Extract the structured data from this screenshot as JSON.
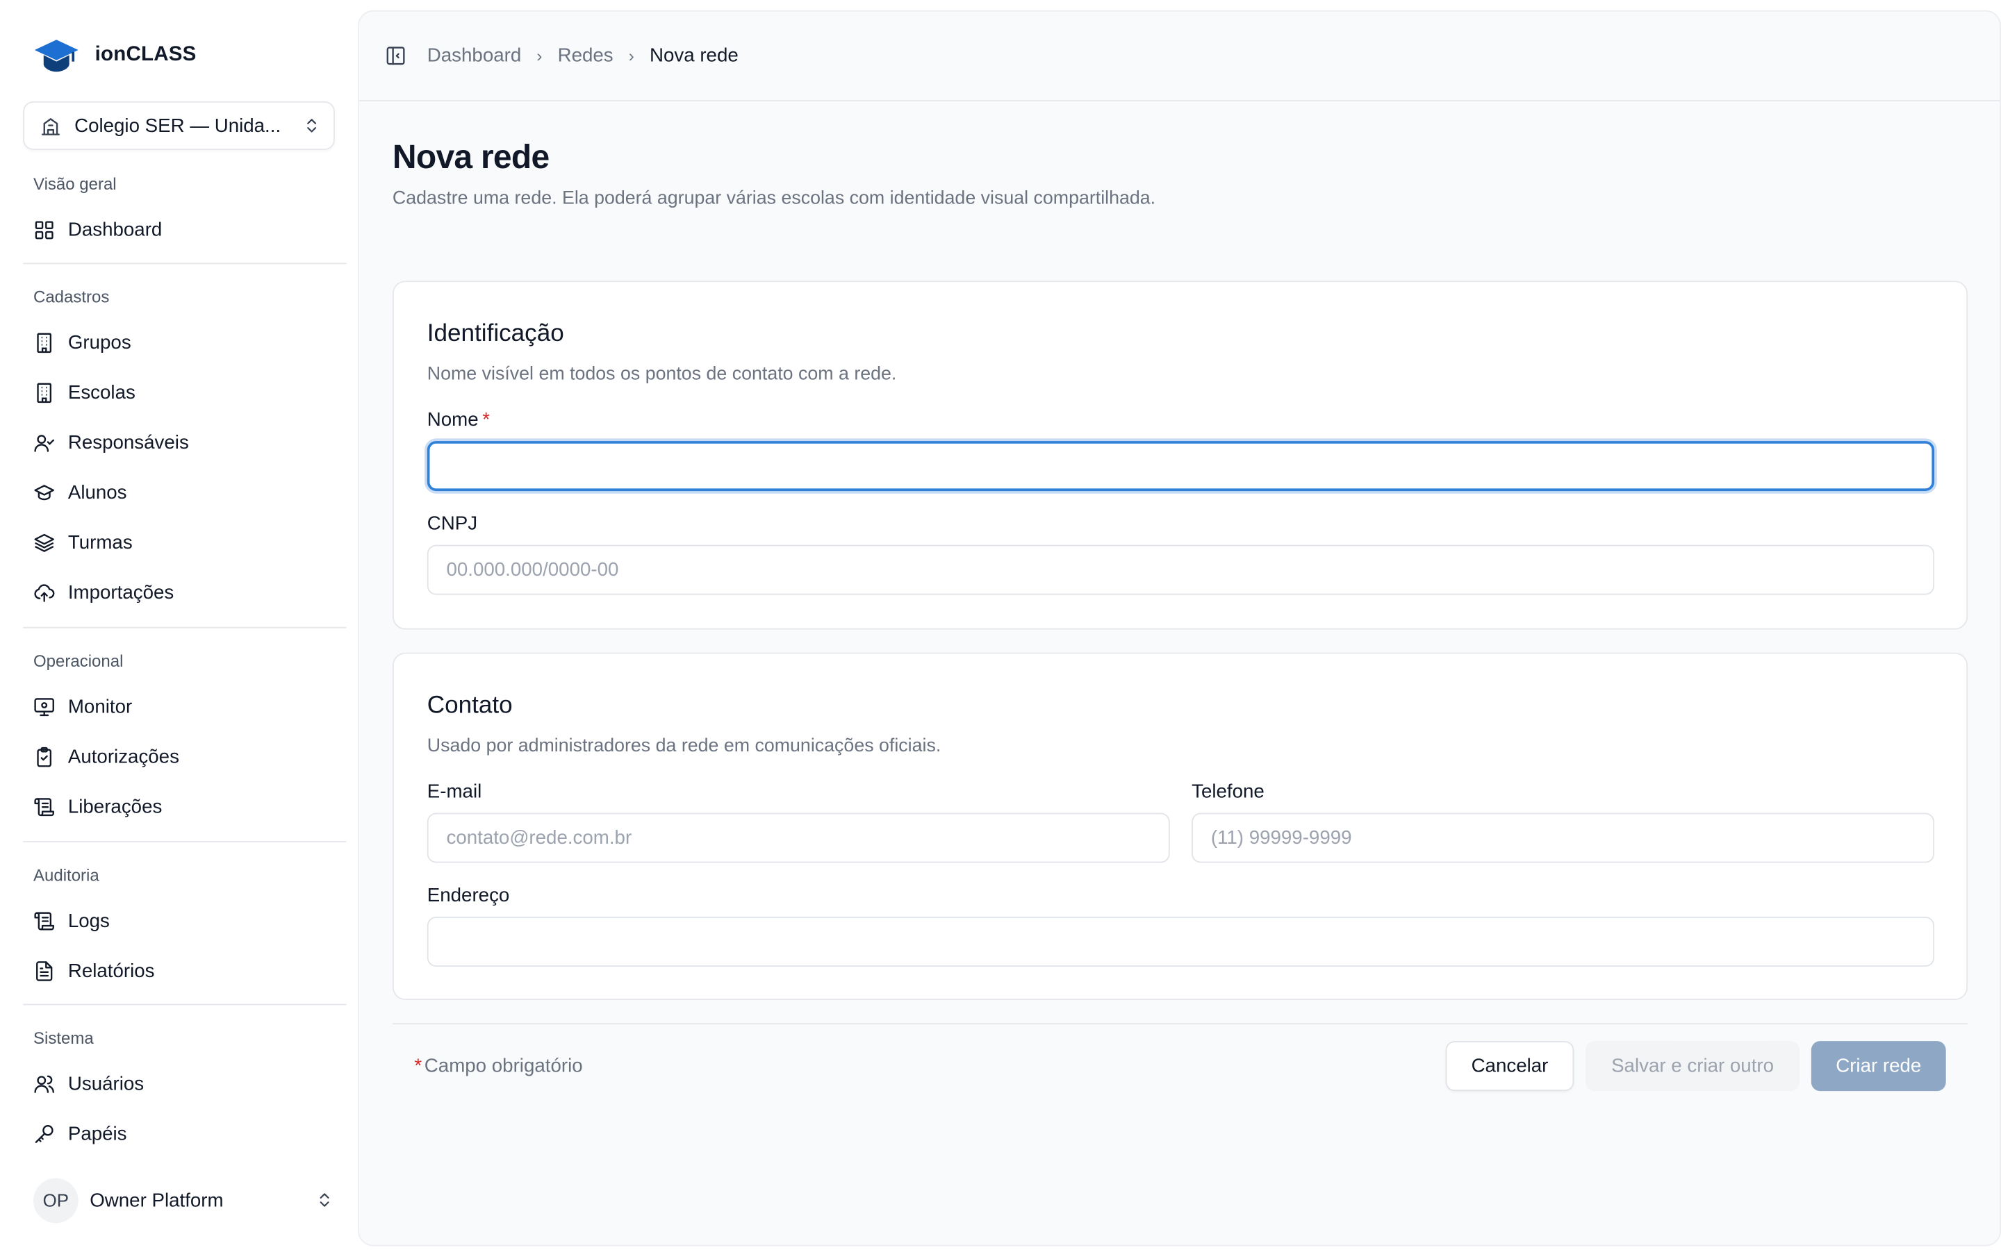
{
  "app": {
    "name": "ionCLASS"
  },
  "school_selector": {
    "value": "Colegio SER — Unida..."
  },
  "sidebar": {
    "sections": [
      {
        "label": "Visão geral",
        "items": [
          {
            "label": "Dashboard",
            "icon": "dashboard-icon"
          }
        ]
      },
      {
        "label": "Cadastros",
        "items": [
          {
            "label": "Grupos",
            "icon": "building-icon"
          },
          {
            "label": "Escolas",
            "icon": "building-icon"
          },
          {
            "label": "Responsáveis",
            "icon": "user-check-icon"
          },
          {
            "label": "Alunos",
            "icon": "graduation-cap-icon"
          },
          {
            "label": "Turmas",
            "icon": "layers-icon"
          },
          {
            "label": "Importações",
            "icon": "upload-cloud-icon"
          }
        ]
      },
      {
        "label": "Operacional",
        "items": [
          {
            "label": "Monitor",
            "icon": "monitor-icon"
          },
          {
            "label": "Autorizações",
            "icon": "clipboard-check-icon"
          },
          {
            "label": "Liberações",
            "icon": "scroll-icon"
          }
        ]
      },
      {
        "label": "Auditoria",
        "items": [
          {
            "label": "Logs",
            "icon": "scroll-icon"
          },
          {
            "label": "Relatórios",
            "icon": "file-text-icon"
          }
        ]
      },
      {
        "label": "Sistema",
        "items": [
          {
            "label": "Usuários",
            "icon": "users-icon"
          },
          {
            "label": "Papéis",
            "icon": "key-icon"
          }
        ]
      }
    ]
  },
  "user": {
    "initials": "OP",
    "name": "Owner Platform"
  },
  "breadcrumb": {
    "items": [
      "Dashboard",
      "Redes"
    ],
    "current": "Nova rede"
  },
  "page": {
    "title": "Nova rede",
    "subtitle": "Cadastre uma rede. Ela poderá agrupar várias escolas com identidade visual compartilhada."
  },
  "identificacao": {
    "title": "Identificação",
    "subtitle": "Nome visível em todos os pontos de contato com a rede.",
    "nome_label": "Nome",
    "required_mark": "*",
    "nome_value": "",
    "cnpj_label": "CNPJ",
    "cnpj_placeholder": "00.000.000/0000-00"
  },
  "contato": {
    "title": "Contato",
    "subtitle": "Usado por administradores da rede em comunicações oficiais.",
    "email_label": "E-mail",
    "email_placeholder": "contato@rede.com.br",
    "telefone_label": "Telefone",
    "telefone_placeholder": "(11) 99999-9999",
    "endereco_label": "Endereço",
    "endereco_value": ""
  },
  "footer": {
    "required_mark": "*",
    "required_note": "Campo obrigatório",
    "cancel_label": "Cancelar",
    "save_and_new_label": "Salvar e criar outro",
    "create_label": "Criar rede"
  },
  "colors": {
    "primary_disabled": "#8ea7c4",
    "focus_ring": "#2f80d9",
    "required": "#dc2626",
    "logo": "#1d6fd1"
  }
}
